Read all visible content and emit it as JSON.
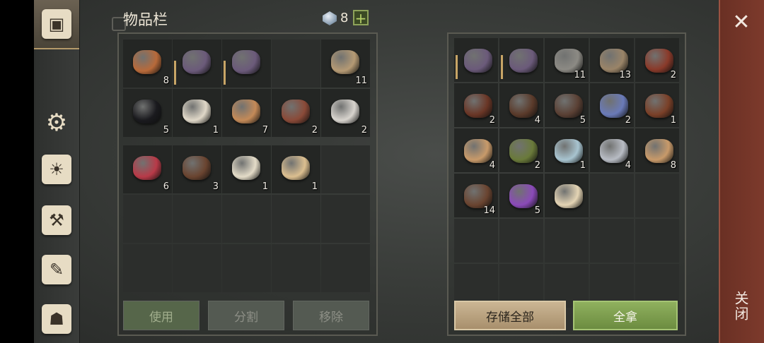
{
  "inventory": {
    "title": "物品栏",
    "gem_count": "8",
    "plus_label": "+",
    "slots": [
      {
        "icon": "berry-bucket-icon",
        "count": "8",
        "color": "#b86a3a"
      },
      {
        "icon": "mace-icon",
        "count": "",
        "color": "#6b5a7a",
        "durability": true
      },
      {
        "icon": "mace-icon",
        "count": "",
        "color": "#6b5a7a",
        "durability": true
      },
      {
        "icon": "",
        "count": ""
      },
      {
        "icon": "rope-icon",
        "count": "11",
        "color": "#b59a74"
      },
      {
        "icon": "coal-icon",
        "count": "5",
        "color": "#1a1a1e"
      },
      {
        "icon": "skull-icon",
        "count": "1",
        "color": "#e0d8c8"
      },
      {
        "icon": "leather-scraps-icon",
        "count": "7",
        "color": "#c48a58"
      },
      {
        "icon": "nails-icon",
        "count": "2",
        "color": "#8a4a38"
      },
      {
        "icon": "ash-pile-icon",
        "count": "2",
        "color": "#d8d4ce"
      },
      {
        "icon": "raw-meat-icon",
        "count": "6",
        "color": "#b83a48"
      },
      {
        "icon": "animal-hide-icon",
        "count": "3",
        "color": "#6a4430"
      },
      {
        "icon": "fang-icon",
        "count": "1",
        "color": "#e4dcc8"
      },
      {
        "icon": "comb-icon",
        "count": "1",
        "color": "#dcbf90"
      }
    ],
    "buttons": {
      "use": "使用",
      "split": "分割",
      "remove": "移除"
    }
  },
  "storage": {
    "slots": [
      {
        "icon": "mace-icon",
        "count": "",
        "color": "#6b5a7a",
        "durability": true
      },
      {
        "icon": "mace-icon",
        "count": "",
        "color": "#6b5a7a",
        "durability": true
      },
      {
        "icon": "stone-icon",
        "count": "11",
        "color": "#8c8a84"
      },
      {
        "icon": "wood-log-icon",
        "count": "13",
        "color": "#9a8468"
      },
      {
        "icon": "rope-trap-icon",
        "count": "2",
        "color": "#8a3a2a"
      },
      {
        "icon": "leather-belt-icon",
        "count": "2",
        "color": "#6a3626"
      },
      {
        "icon": "cord-icon",
        "count": "4",
        "color": "#5a3a2a"
      },
      {
        "icon": "chain-icon",
        "count": "5",
        "color": "#5a4034"
      },
      {
        "icon": "crystal-icon",
        "count": "2",
        "color": "#6a7ab8"
      },
      {
        "icon": "bottle-icon",
        "count": "1",
        "color": "#7a4028"
      },
      {
        "icon": "seeds-icon",
        "count": "4",
        "color": "#c89a6a"
      },
      {
        "icon": "moss-ball-icon",
        "count": "2",
        "color": "#6a7a3a"
      },
      {
        "icon": "water-flask-icon",
        "count": "1",
        "color": "#a8c4d0"
      },
      {
        "icon": "ore-icon",
        "count": "4",
        "color": "#b8bcc4"
      },
      {
        "icon": "cloth-roll-icon",
        "count": "8",
        "color": "#c89a6a"
      },
      {
        "icon": "leather-roll-icon",
        "count": "14",
        "color": "#6a4430"
      },
      {
        "icon": "purple-potion-icon",
        "count": "5",
        "color": "#8a4ab8"
      },
      {
        "icon": "scroll-icon",
        "count": "",
        "color": "#e4d4b4"
      }
    ],
    "buttons": {
      "store_all": "存储全部",
      "take_all": "全拿"
    }
  },
  "sidebar": {
    "tabs": [
      {
        "name": "chest-tab",
        "icon": "chest-icon",
        "glyph": "▣"
      },
      {
        "name": "crafting-tab",
        "icon": "crafting-icon",
        "glyph": "⚙"
      },
      {
        "name": "journal-tab",
        "icon": "sun-book-icon",
        "glyph": "☀"
      },
      {
        "name": "build-tab",
        "icon": "hammer-icon",
        "glyph": "⚒"
      },
      {
        "name": "quest-tab",
        "icon": "scroll-icon",
        "glyph": "✎"
      },
      {
        "name": "character-tab",
        "icon": "character-icon",
        "glyph": "☗"
      }
    ]
  },
  "close": {
    "x": "✕",
    "label": "关闭"
  }
}
